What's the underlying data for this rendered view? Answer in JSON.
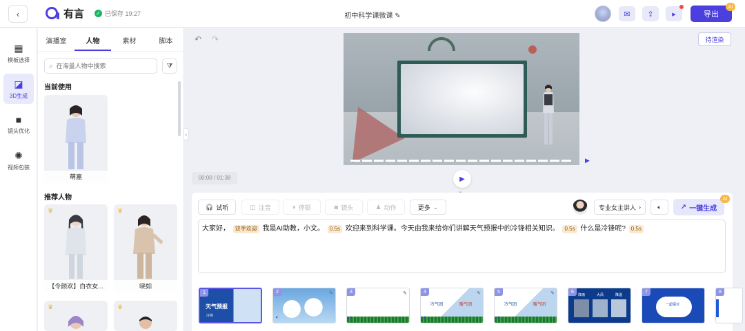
{
  "header": {
    "back_icon": "chevron-left-icon",
    "logo_text": "有言",
    "saved_text": "已保存 19:27",
    "doc_title": "初中科学课微课",
    "export_label": "导出",
    "ai_badge": "AI"
  },
  "nav": {
    "items": [
      {
        "label": "模板选择",
        "icon": "grid-icon"
      },
      {
        "label": "3D生成",
        "icon": "chart-icon"
      },
      {
        "label": "镜头优化",
        "icon": "video-camera-icon"
      },
      {
        "label": "视频包装",
        "icon": "film-reel-icon"
      }
    ]
  },
  "panel": {
    "tabs": [
      "演播室",
      "人物",
      "素材",
      "脚本"
    ],
    "active_tab": "人物",
    "search_placeholder": "在海量人物中搜索",
    "current_title": "当前使用",
    "current_name": "萌嘉",
    "recommend_title": "推荐人物",
    "recommend": [
      {
        "name": "【令颜欢】白衣女..."
      },
      {
        "name": "晓如"
      },
      {
        "name": ""
      },
      {
        "name": ""
      }
    ]
  },
  "stage": {
    "render_label": "待渲染",
    "time": "00:00 / 01:38"
  },
  "editor": {
    "toolbar": {
      "listen": "试听",
      "note": "注音",
      "pause": "停顿",
      "shot": "镜头",
      "action": "动作",
      "more": "更多",
      "presenter": "专业女主讲人",
      "generate": "一键生成",
      "gen_badge": "AI"
    },
    "script": {
      "t1": "大家好，",
      "tag1": "双手欢迎",
      "t2": "我是AI助教，小文。",
      "tag2": "0.5s",
      "t3": "欢迎来到科学课。今天由我来给你们讲解天气预报中的冷锋相关知识。",
      "tag3": "0.5s",
      "t4": "什么是冷锋呢?",
      "tag4": "0.5s"
    }
  },
  "slides": [
    {
      "num": "1",
      "title": "天气预报",
      "sub": "冷锋"
    },
    {
      "num": "2",
      "title": "",
      "sub": ""
    },
    {
      "num": "3",
      "title": "",
      "sub": ""
    },
    {
      "num": "4",
      "title": "冷气团",
      "sub": "暖气团"
    },
    {
      "num": "5",
      "title": "冷气团",
      "sub": "暖气团"
    },
    {
      "num": "6",
      "title": "",
      "sub": "",
      "labels": [
        "阵雨",
        "大风",
        "降温"
      ]
    },
    {
      "num": "7",
      "title": "一起探讨",
      "sub": ""
    },
    {
      "num": "8",
      "title": "",
      "sub": ""
    }
  ],
  "colors": {
    "accent": "#4b3fe0",
    "badge": "#f7b84a",
    "tag_bg": "#fbe9cf"
  }
}
